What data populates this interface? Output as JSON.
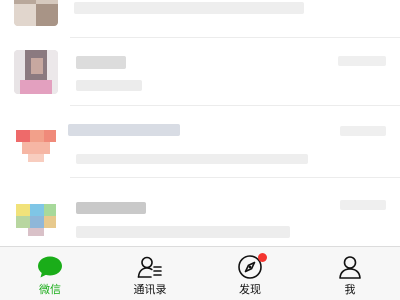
{
  "colors": {
    "accent": "#1aad19",
    "badge": "#f43530",
    "tabbar_bg": "#f7f7f7"
  },
  "chat_list": {
    "items": [
      {
        "name": "",
        "preview": "",
        "time": "",
        "avatar": "photo-avatar-icon"
      },
      {
        "name": "",
        "preview": "",
        "time": "",
        "avatar": "photo-avatar-icon"
      },
      {
        "name": "",
        "preview": "",
        "time": "",
        "avatar": "group-avatar-icon"
      },
      {
        "name": "",
        "preview": "",
        "time": "",
        "avatar": "group-avatar-icon"
      }
    ]
  },
  "tabbar": {
    "tabs": [
      {
        "label": "微信",
        "icon": "chat-bubble-icon",
        "active": true
      },
      {
        "label": "通讯录",
        "icon": "contacts-icon",
        "active": false
      },
      {
        "label": "发现",
        "icon": "compass-icon",
        "active": false,
        "badge_dot": true
      },
      {
        "label": "我",
        "icon": "person-icon",
        "active": false
      }
    ]
  }
}
